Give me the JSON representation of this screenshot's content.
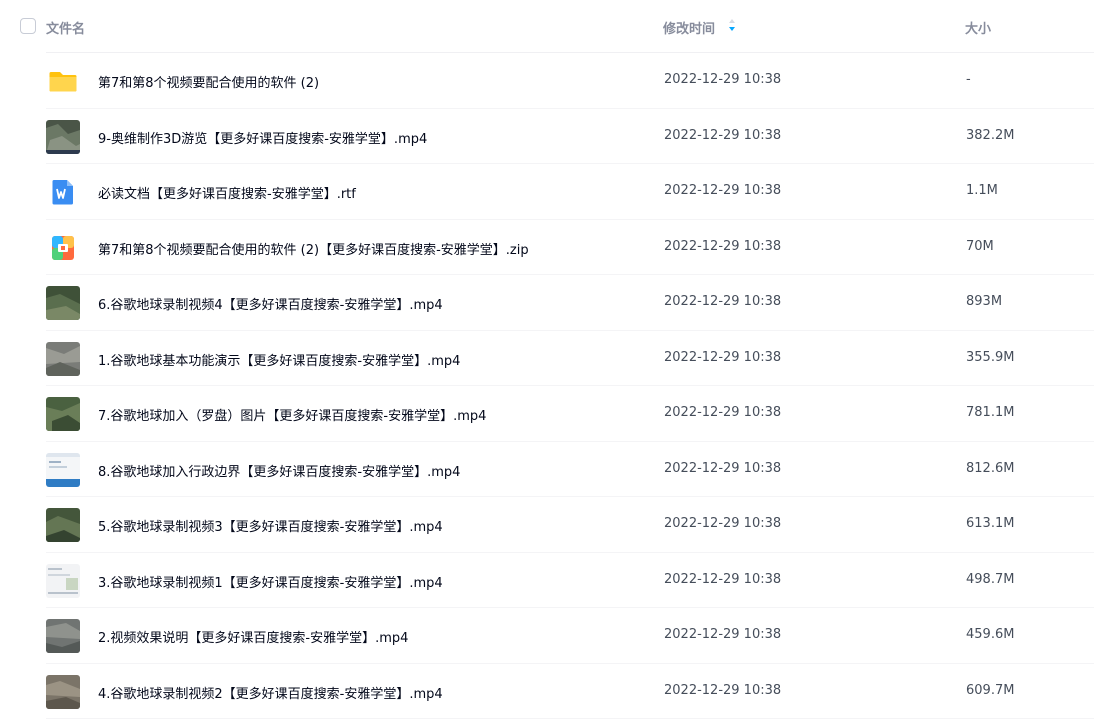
{
  "header": {
    "name_label": "文件名",
    "mtime_label": "修改时间",
    "size_label": "大小"
  },
  "files": [
    {
      "icon": "folder-icon",
      "name": "第7和第8个视频要配合使用的软件 (2)",
      "mtime": "2022-12-29 10:38",
      "size": "-"
    },
    {
      "icon": "video-thumb-icon",
      "name": "9-奥维制作3D游览【更多好课百度搜索-安雅学堂】.mp4",
      "mtime": "2022-12-29 10:38",
      "size": "382.2M"
    },
    {
      "icon": "doc-icon",
      "name": "必读文档【更多好课百度搜索-安雅学堂】.rtf",
      "mtime": "2022-12-29 10:38",
      "size": "1.1M"
    },
    {
      "icon": "zip-icon",
      "name": "第7和第8个视频要配合使用的软件 (2)【更多好课百度搜索-安雅学堂】.zip",
      "mtime": "2022-12-29 10:38",
      "size": "70M"
    },
    {
      "icon": "video-thumb-icon",
      "name": "6.谷歌地球录制视频4【更多好课百度搜索-安雅学堂】.mp4",
      "mtime": "2022-12-29 10:38",
      "size": "893M"
    },
    {
      "icon": "video-thumb-icon",
      "name": "1.谷歌地球基本功能演示【更多好课百度搜索-安雅学堂】.mp4",
      "mtime": "2022-12-29 10:38",
      "size": "355.9M"
    },
    {
      "icon": "video-thumb-icon",
      "name": "7.谷歌地球加入（罗盘）图片【更多好课百度搜索-安雅学堂】.mp4",
      "mtime": "2022-12-29 10:38",
      "size": "781.1M"
    },
    {
      "icon": "video-thumb-icon",
      "name": "8.谷歌地球加入行政边界【更多好课百度搜索-安雅学堂】.mp4",
      "mtime": "2022-12-29 10:38",
      "size": "812.6M"
    },
    {
      "icon": "video-thumb-icon",
      "name": "5.谷歌地球录制视频3【更多好课百度搜索-安雅学堂】.mp4",
      "mtime": "2022-12-29 10:38",
      "size": "613.1M"
    },
    {
      "icon": "video-thumb-icon",
      "name": "3.谷歌地球录制视频1【更多好课百度搜索-安雅学堂】.mp4",
      "mtime": "2022-12-29 10:38",
      "size": "498.7M"
    },
    {
      "icon": "video-thumb-icon",
      "name": "2.视频效果说明【更多好课百度搜索-安雅学堂】.mp4",
      "mtime": "2022-12-29 10:38",
      "size": "459.6M"
    },
    {
      "icon": "video-thumb-icon",
      "name": "4.谷歌地球录制视频2【更多好课百度搜索-安雅学堂】.mp4",
      "mtime": "2022-12-29 10:38",
      "size": "609.7M"
    }
  ]
}
